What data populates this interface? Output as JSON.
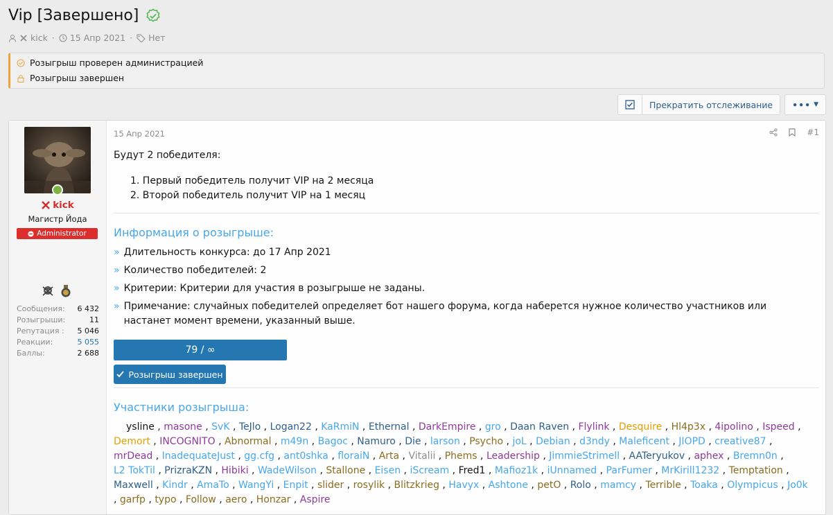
{
  "thread": {
    "title": "Vip [Завершено]",
    "author": "kick",
    "date": "15 Апр 2021",
    "tags": "Нет"
  },
  "notices": [
    "Розыгрыш проверен администрацией",
    "Розыгрыш завершен"
  ],
  "toolbar": {
    "watch_label": "Прекратить отслеживание"
  },
  "user": {
    "name": "kick",
    "title": "Магистр Йода",
    "badge": "Administrator",
    "stats": [
      {
        "label": "Сообщения:",
        "value": "6 432",
        "link": false
      },
      {
        "label": "Розыгрыши:",
        "value": "11",
        "link": false
      },
      {
        "label": "Репутация :",
        "value": "5 046",
        "link": false
      },
      {
        "label": "Реакции:",
        "value": "5 055",
        "link": true
      },
      {
        "label": "Баллы:",
        "value": "2 688",
        "link": false
      }
    ]
  },
  "post": {
    "date": "15 Апр 2021",
    "number": "#1",
    "intro": "Будут 2 победителя:",
    "list": [
      "1. Первый победитель получит VIP на 2 месяца",
      "2. Второй победитель получит VIP на 1 месяц"
    ],
    "info_title": "Информация о розыгрыше:",
    "info": [
      "Длительность конкурса: до 17 Апр 2021",
      "Количество победителей: 2",
      "Критерии: Критерии для участия в розыгрыше не заданы.",
      "Примечание: случайных победителей определяет бот нашего форума, когда наберется нужное количество участников или настанет момент времени, указанный выше."
    ],
    "progress_text": "79 / ∞",
    "progress_fraction": 1.0,
    "done_button": "Розыгрыш завершен",
    "participants_title": "Участники розыгрыша:"
  },
  "participants": [
    {
      "n": "ysline",
      "c": "#141414"
    },
    {
      "n": "masone",
      "c": "#8e3a99"
    },
    {
      "n": "SvK",
      "c": "#47a7eb"
    },
    {
      "n": "TeJlo",
      "c": "#2e5f8a"
    },
    {
      "n": "Logan22",
      "c": "#2e5f8a"
    },
    {
      "n": "KaRmiN",
      "c": "#47a7eb"
    },
    {
      "n": "Ethernal",
      "c": "#2e5f8a"
    },
    {
      "n": "DarkEmpire",
      "c": "#8e3a99"
    },
    {
      "n": "gro",
      "c": "#47a7eb"
    },
    {
      "n": "Daan Raven",
      "c": "#2e5f8a"
    },
    {
      "n": "Flylink",
      "c": "#8e3a99"
    },
    {
      "n": "Desquire",
      "c": "#e0a000"
    },
    {
      "n": "Hl4p3x",
      "c": "#8a6d1f"
    },
    {
      "n": "4ipolino",
      "c": "#8e3a99"
    },
    {
      "n": "Ispeed",
      "c": "#8e3a99"
    },
    {
      "n": "Demort",
      "c": "#e0a000"
    },
    {
      "n": "INCOGNITO",
      "c": "#8e3a99"
    },
    {
      "n": "Abnormal",
      "c": "#8a6d1f"
    },
    {
      "n": "m49n",
      "c": "#47a7eb"
    },
    {
      "n": "Bagoc",
      "c": "#47a7eb"
    },
    {
      "n": "Namuro",
      "c": "#2e5f8a"
    },
    {
      "n": "Die",
      "c": "#2e5f8a"
    },
    {
      "n": "larson",
      "c": "#47a7eb"
    },
    {
      "n": "Psycho",
      "c": "#8a6d1f"
    },
    {
      "n": "joL",
      "c": "#47a7eb"
    },
    {
      "n": "Debian",
      "c": "#47a7eb"
    },
    {
      "n": "d3ndy",
      "c": "#47a7eb"
    },
    {
      "n": "Maleficent",
      "c": "#47a7eb"
    },
    {
      "n": "JIOPD",
      "c": "#47a7eb"
    },
    {
      "n": "creative87",
      "c": "#47a7eb"
    },
    {
      "n": "mrDead",
      "c": "#8e3a99"
    },
    {
      "n": "InadequateJust",
      "c": "#47a7eb"
    },
    {
      "n": "gg.cfg",
      "c": "#47a7eb"
    },
    {
      "n": "ant0shka",
      "c": "#47a7eb"
    },
    {
      "n": "floraiN",
      "c": "#47a7eb"
    },
    {
      "n": "Arta",
      "c": "#8a6d1f"
    },
    {
      "n": "Vitalii",
      "c": "#8c8c8c"
    },
    {
      "n": "Phems",
      "c": "#8a6d1f"
    },
    {
      "n": "Leadership",
      "c": "#8e3a99"
    },
    {
      "n": "JimmieStrimell",
      "c": "#47a7eb"
    },
    {
      "n": "AATeryukov",
      "c": "#2e5f8a"
    },
    {
      "n": "aphex",
      "c": "#8e3a99"
    },
    {
      "n": "Bremn0n",
      "c": "#47a7eb"
    },
    {
      "n": "L2 TokTil",
      "c": "#47a7eb"
    },
    {
      "n": "PrizraKZN",
      "c": "#2e5f8a"
    },
    {
      "n": "Hibiki",
      "c": "#8e3a99"
    },
    {
      "n": "WadeWilson",
      "c": "#47a7eb"
    },
    {
      "n": "Stallone",
      "c": "#8a6d1f"
    },
    {
      "n": "Eisen",
      "c": "#47a7eb"
    },
    {
      "n": "iScream",
      "c": "#47a7eb"
    },
    {
      "n": "Fred1",
      "c": "#141414"
    },
    {
      "n": "Mafioz1k",
      "c": "#47a7eb"
    },
    {
      "n": "iUnnamed",
      "c": "#47a7eb"
    },
    {
      "n": "ParFumer",
      "c": "#47a7eb"
    },
    {
      "n": "MrKirill1232",
      "c": "#47a7eb"
    },
    {
      "n": "Temptation",
      "c": "#8a6d1f"
    },
    {
      "n": "Maxwell",
      "c": "#2e5f8a"
    },
    {
      "n": "Kindr",
      "c": "#47a7eb"
    },
    {
      "n": "AmaTo",
      "c": "#47a7eb"
    },
    {
      "n": "WangYi",
      "c": "#47a7eb"
    },
    {
      "n": "Enpit",
      "c": "#47a7eb"
    },
    {
      "n": "slider",
      "c": "#8a6d1f"
    },
    {
      "n": "rosylik",
      "c": "#8a6d1f"
    },
    {
      "n": "Blitzkrieg",
      "c": "#8a6d1f"
    },
    {
      "n": "Havyx",
      "c": "#47a7eb"
    },
    {
      "n": "Ashtone",
      "c": "#47a7eb"
    },
    {
      "n": "petO",
      "c": "#8a6d1f"
    },
    {
      "n": "Rolo",
      "c": "#2e5f8a"
    },
    {
      "n": "mamcy",
      "c": "#47a7eb"
    },
    {
      "n": "Terrible",
      "c": "#8a6d1f"
    },
    {
      "n": "Toaka",
      "c": "#47a7eb"
    },
    {
      "n": "Olympicus",
      "c": "#47a7eb"
    },
    {
      "n": "Jo0k",
      "c": "#47a7eb"
    },
    {
      "n": "garfp",
      "c": "#8a6d1f"
    },
    {
      "n": "typo",
      "c": "#8a6d1f"
    },
    {
      "n": "Follow",
      "c": "#8a6d1f"
    },
    {
      "n": "aero",
      "c": "#8a6d1f"
    },
    {
      "n": "Honzar",
      "c": "#8a6d1f"
    },
    {
      "n": "Aspire",
      "c": "#8e3a99"
    }
  ]
}
